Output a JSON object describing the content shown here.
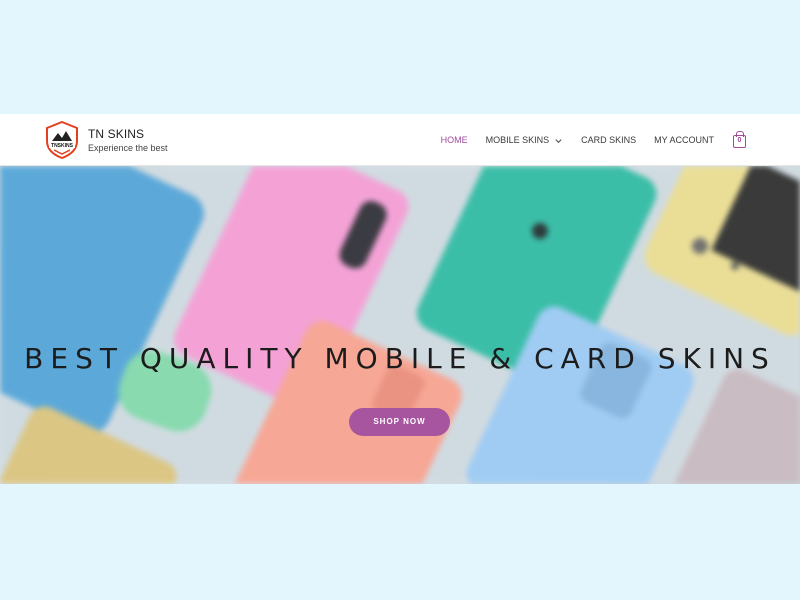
{
  "header": {
    "site_title": "TN SKINS",
    "tagline": "Experience the best",
    "logo_text": "TNSKINS"
  },
  "nav": {
    "items": [
      {
        "label": "HOME",
        "active": true
      },
      {
        "label": "MOBILE SKINS",
        "has_dropdown": true
      },
      {
        "label": "CARD SKINS"
      },
      {
        "label": "MY ACCOUNT"
      }
    ],
    "cart_count": "0"
  },
  "hero": {
    "heading": "BEST QUALITY MOBILE & CARD SKINS",
    "button_label": "SHOP NOW"
  },
  "colors": {
    "accent": "#a8559f",
    "page_background": "#e3f6fd"
  }
}
